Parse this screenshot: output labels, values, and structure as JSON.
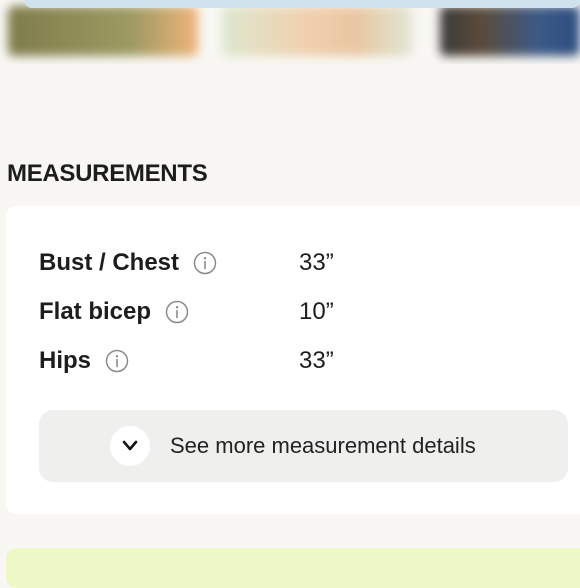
{
  "section": {
    "title": "MEASUREMENTS"
  },
  "measurements": [
    {
      "label": "Bust / Chest",
      "value": "33”"
    },
    {
      "label": "Flat bicep",
      "value": "10”"
    },
    {
      "label": "Hips",
      "value": "33”"
    }
  ],
  "see_more": {
    "label": "See more measurement details"
  },
  "icons": {
    "info": "info-icon",
    "expand": "chevron-down-icon"
  },
  "colors": {
    "page_bg": "#f8f7f3",
    "card_bg": "#ffffff",
    "button_bg": "#efefed",
    "accent_strip": "#eef9c7"
  }
}
